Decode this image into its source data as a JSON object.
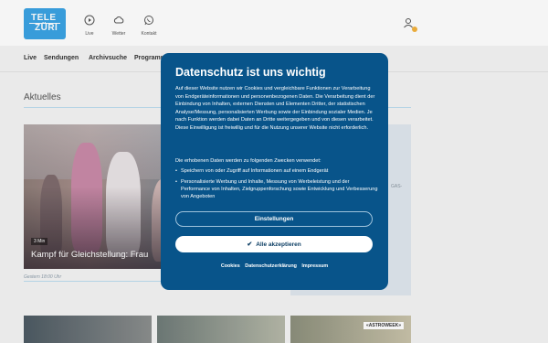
{
  "header": {
    "logo": {
      "line1": "TELE",
      "line2": "ZÜRI"
    },
    "nav": [
      {
        "label": "Live",
        "icon": "play-icon"
      },
      {
        "label": "Wetter",
        "icon": "cloud-icon"
      },
      {
        "label": "Kontakt",
        "icon": "whatsapp-icon"
      }
    ],
    "user_icon": "user-icon"
  },
  "subnav": [
    "Live",
    "Sendungen",
    "Archivsuche",
    "Programm"
  ],
  "content": {
    "section_title": "Aktuelles",
    "main_card": {
      "badge": "3 Min",
      "title": "Kampf für Gleichstellung: Frau"
    },
    "timestamp": "Gestern 18:00 Uhr",
    "side_ad_fragment": "GAS-",
    "thumb_badge": "«ASTROWEEK»"
  },
  "consent": {
    "title": "Datenschutz ist uns wichtig",
    "body": "Auf dieser Website nutzen wir Cookies und vergleichbare Funktionen zur Verarbeitung von Endgeräteinformationen und personenbezogenen Daten. Die Verarbeitung dient der Einbindung von Inhalten, externen Diensten und Elementen Dritter, der statistischen Analyse/Messung, personalisierten Werbung sowie der Einbindung sozialer Medien. Je nach Funktion werden dabei Daten an Dritte weitergegeben und von diesen verarbeitet. Diese Einwilligung ist freiwillig und für die Nutzung unserer Website nicht erforderlich.",
    "purposes_intro": "Die erhobenen Daten werden zu folgenden Zwecken verwendet:",
    "purposes": [
      "Speichern von oder Zugriff auf Informationen auf einem Endgerät",
      "Personalisierte Werbung und Inhalte, Messung von Werbeleistung und der Performance von Inhalten, Zielgruppenforschung sowie Entwicklung und Verbesserung von Angeboten"
    ],
    "settings_label": "Einstellungen",
    "accept_label": "Alle akzeptieren",
    "links": [
      "Cookies",
      "Datenschutzerklärung",
      "Impressum"
    ]
  },
  "colors": {
    "logo_blue": "#3ba3e3",
    "modal_blue": "#08548a",
    "accent_line": "#bcdcef",
    "notification_dot": "#f3b23e"
  }
}
